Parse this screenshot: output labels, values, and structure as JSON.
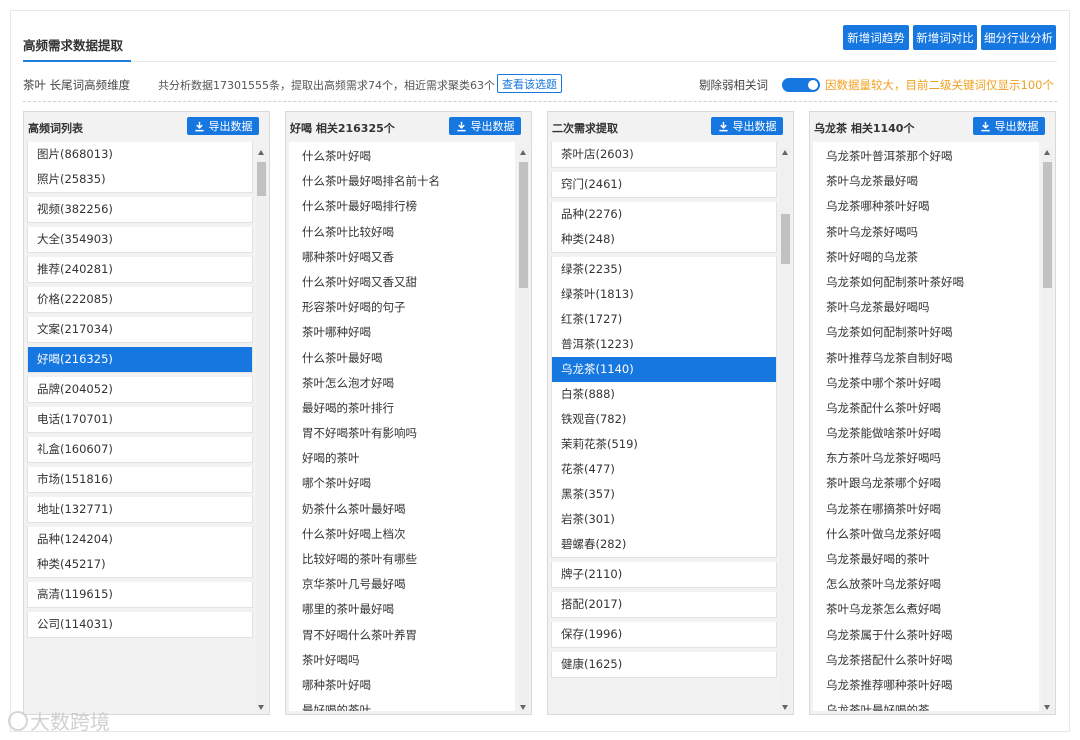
{
  "header": {
    "title": "高频需求数据提取",
    "buttons": [
      "新增词趋势",
      "新增词对比",
      "细分行业分析"
    ]
  },
  "info": {
    "keyword": "茶叶 长尾词高频维度",
    "stats": "共分析数据17301555条，提取出高频需求74个，相近需求聚类63个",
    "view_button": "查看该选题",
    "toggle_label": "剔除弱相关词",
    "toggle_on": true,
    "warning": "因数据量较大，目前二级关键词仅显示100个"
  },
  "colors": {
    "accent": "#1677e0",
    "warning": "#f0a020"
  },
  "export_label": "导出数据",
  "panel1": {
    "title": "高频词列表",
    "groups": [
      [
        "图片(868013)",
        "照片(25835)"
      ],
      [
        "视频(382256)"
      ],
      [
        "大全(354903)"
      ],
      [
        "推荐(240281)"
      ],
      [
        "价格(222085)"
      ],
      [
        "文案(217034)"
      ],
      [
        "好喝(216325)"
      ],
      [
        "品牌(204052)"
      ],
      [
        "电话(170701)"
      ],
      [
        "礼盒(160607)"
      ],
      [
        "市场(151816)"
      ],
      [
        "地址(132771)"
      ],
      [
        "品种(124204)",
        "种类(45217)"
      ],
      [
        "高清(119615)"
      ],
      [
        "公司(114031)"
      ]
    ],
    "active": "好喝(216325)"
  },
  "panel2": {
    "title": "好喝 相关216325个",
    "items": [
      "什么茶叶好喝",
      "什么茶叶最好喝排名前十名",
      "什么茶叶最好喝排行榜",
      "什么茶叶比较好喝",
      "哪种茶叶好喝又香",
      "什么茶叶好喝又香又甜",
      "形容茶叶好喝的句子",
      "茶叶哪种好喝",
      "什么茶叶最好喝",
      "茶叶怎么泡才好喝",
      "最好喝的茶叶排行",
      "胃不好喝茶叶有影响吗",
      "好喝的茶叶",
      "哪个茶叶好喝",
      "奶茶什么茶叶最好喝",
      "什么茶叶好喝上档次",
      "比较好喝的茶叶有哪些",
      "京华茶叶几号最好喝",
      "哪里的茶叶最好喝",
      "胃不好喝什么茶叶养胃",
      "茶叶好喝吗",
      "哪种茶叶好喝",
      "最好喝的茶叶"
    ]
  },
  "panel3": {
    "title": "二次需求提取",
    "groups": [
      [
        "茶叶店(2603)"
      ],
      [
        "窍门(2461)"
      ],
      [
        "品种(2276)",
        "种类(248)"
      ],
      [
        "绿茶(2235)",
        "绿茶叶(1813)",
        "红茶(1727)",
        "普洱茶(1223)",
        "乌龙茶(1140)",
        "白茶(888)",
        "铁观音(782)",
        "茉莉花茶(519)",
        "花茶(477)",
        "黑茶(357)",
        "岩茶(301)",
        "碧螺春(282)"
      ],
      [
        "牌子(2110)"
      ],
      [
        "搭配(2017)"
      ],
      [
        "保存(1996)"
      ],
      [
        "健康(1625)"
      ]
    ],
    "active": "乌龙茶(1140)"
  },
  "panel4": {
    "title": "乌龙茶 相关1140个",
    "items": [
      "乌龙茶叶普洱茶那个好喝",
      "茶叶乌龙茶最好喝",
      "乌龙茶哪种茶叶好喝",
      "茶叶乌龙茶好喝吗",
      "茶叶好喝的乌龙茶",
      "乌龙茶如何配制茶叶茶好喝",
      "茶叶乌龙茶最好喝吗",
      "乌龙茶如何配制茶叶好喝",
      "茶叶推荐乌龙茶自制好喝",
      "乌龙茶中哪个茶叶好喝",
      "乌龙茶配什么茶叶好喝",
      "乌龙茶能做啥茶叶好喝",
      "东方茶叶乌龙茶好喝吗",
      "茶叶跟乌龙茶哪个好喝",
      "乌龙茶在哪摘茶叶好喝",
      "什么茶叶做乌龙茶好喝",
      "乌龙茶最好喝的茶叶",
      "怎么放茶叶乌龙茶好喝",
      "茶叶乌龙茶怎么煮好喝",
      "乌龙茶属于什么茶叶好喝",
      "乌龙茶搭配什么茶叶好喝",
      "乌龙茶推荐哪种茶叶好喝",
      "乌龙茶叶最好喝的茶"
    ]
  },
  "watermark": "大数跨境"
}
